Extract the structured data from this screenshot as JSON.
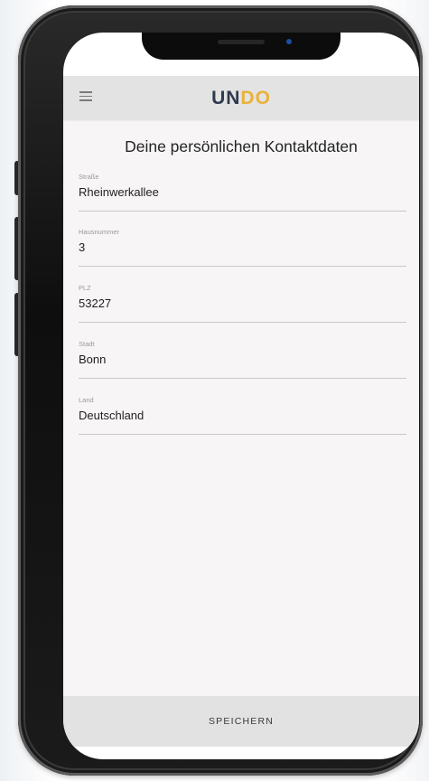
{
  "app": {
    "logo_left": "UN",
    "logo_right": "DO"
  },
  "page": {
    "title": "Deine persönlichen Kontaktdaten"
  },
  "form": {
    "fields": [
      {
        "label": "Straße",
        "value": "Rheinwerkallee"
      },
      {
        "label": "Hausnummer",
        "value": "3"
      },
      {
        "label": "PLZ",
        "value": "53227"
      },
      {
        "label": "Stadt",
        "value": "Bonn"
      },
      {
        "label": "Land",
        "value": "Deutschland"
      }
    ]
  },
  "footer": {
    "save_label": "SPEICHERN"
  },
  "colors": {
    "logo_accent": "#e9b23a",
    "logo_dark": "#2f3b4e",
    "appbar_bg": "#e3e3e3",
    "content_bg": "#f7f5f6"
  },
  "icons": {
    "menu": "hamburger-menu-icon"
  }
}
